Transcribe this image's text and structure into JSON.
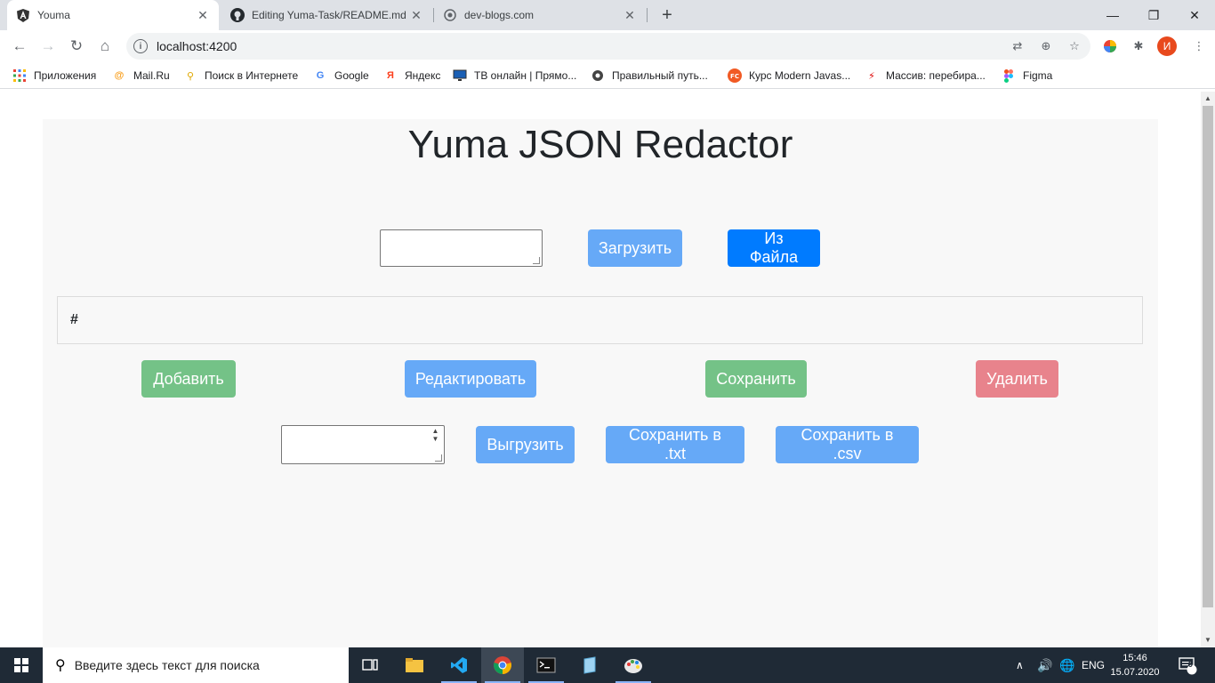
{
  "browser": {
    "tabs": [
      {
        "title": "Youma",
        "active": true
      },
      {
        "title": "Editing Yuma-Task/README.md at",
        "active": false
      },
      {
        "title": "dev-blogs.com",
        "active": false
      }
    ],
    "url": "localhost:4200",
    "profile_initial": "И",
    "bookmarks": [
      "Приложения",
      "Mail.Ru",
      "Поиск в Интернете",
      "Google",
      "Яндекс",
      "ТВ онлайн | Прямо...",
      "Правильный путь...",
      "Курс Modern Javas...",
      "Массив: перебира...",
      "Figma"
    ]
  },
  "app": {
    "title": "Yuma JSON Redactor",
    "load_button": "Загрузить",
    "from_file_button": "Из Файла",
    "list_header": "#",
    "add_button": "Добавить",
    "edit_button": "Редактировать",
    "save_button": "Сохранить",
    "delete_button": "Удалить",
    "export_button": "Выгрузить",
    "save_txt_button": "Сохранить в .txt",
    "save_csv_button": "Сохранить в .csv"
  },
  "taskbar": {
    "search_placeholder": "Введите здесь текст для поиска",
    "lang": "ENG",
    "time": "15:46",
    "date": "15.07.2020",
    "notifications": "9"
  },
  "colors": {
    "primary": "#007bff",
    "primary_light": "#66a9f7",
    "success_light": "#74c287",
    "danger_light": "#e8838c"
  }
}
